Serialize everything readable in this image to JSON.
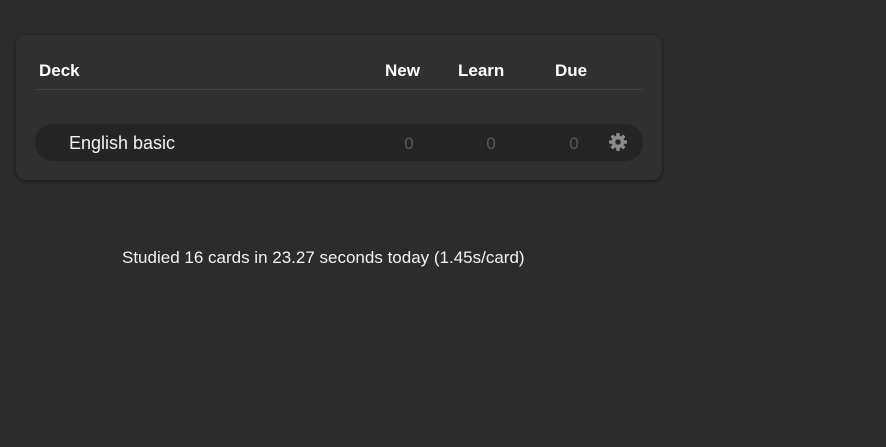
{
  "deck_table": {
    "headers": {
      "deck": "Deck",
      "new": "New",
      "learn": "Learn",
      "due": "Due"
    },
    "rows": [
      {
        "name": "English basic",
        "new": "0",
        "learn": "0",
        "due": "0",
        "options_icon": "gear-icon"
      }
    ]
  },
  "stats": {
    "text": "Studied 16 cards in 23.27 seconds today (1.45s/card)"
  },
  "colors": {
    "background": "#2c2c2c",
    "panel": "#303030",
    "row": "#252525",
    "muted_count": "#5a5a5a",
    "gear": "#8a8a8a"
  }
}
